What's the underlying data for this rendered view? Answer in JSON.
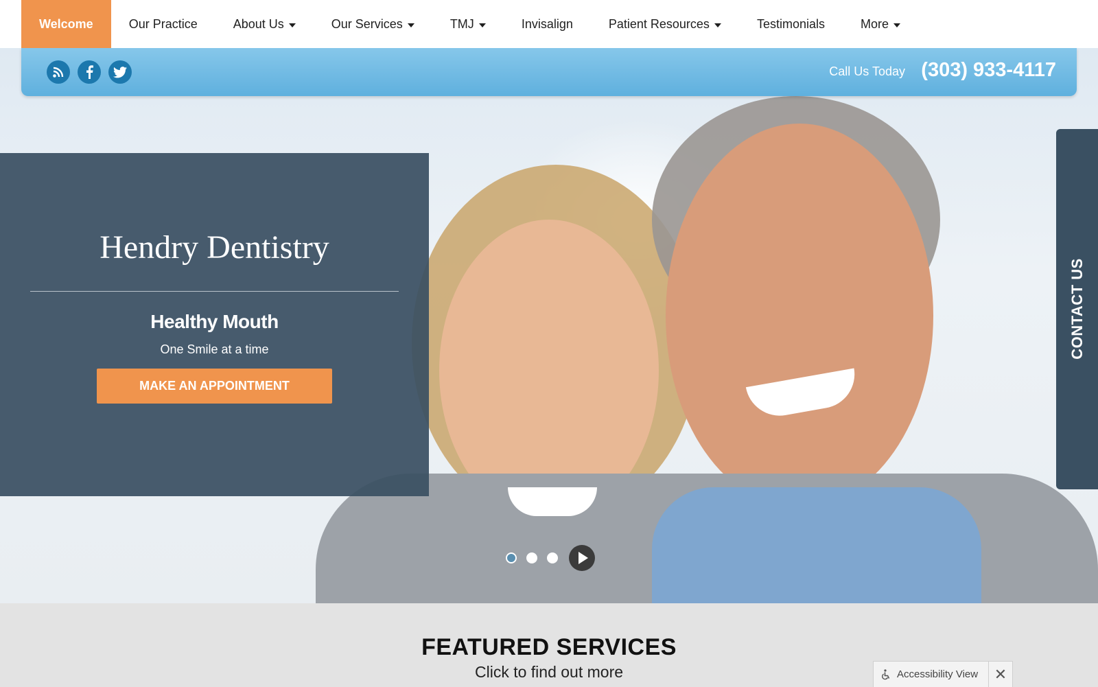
{
  "nav": {
    "items": [
      {
        "label": "Welcome"
      },
      {
        "label": "Our Practice"
      },
      {
        "label": "About Us"
      },
      {
        "label": "Our Services"
      },
      {
        "label": "TMJ"
      },
      {
        "label": "Invisalign"
      },
      {
        "label": "Patient Resources"
      },
      {
        "label": "Testimonials"
      },
      {
        "label": "More"
      }
    ]
  },
  "topbar": {
    "social_icons": [
      "rss-icon",
      "facebook-icon",
      "twitter-icon"
    ],
    "call_label": "Call Us Today",
    "phone": "(303) 933-4117"
  },
  "hero": {
    "title": "Hendry Dentistry",
    "heading": "Healthy Mouth",
    "subheading": "One Smile at a time",
    "cta_label": "MAKE AN APPOINTMENT",
    "slides": 3,
    "active_slide": 1
  },
  "contact_tab": {
    "label": "CONTACT US"
  },
  "featured": {
    "title": "FEATURED SERVICES",
    "subtitle": "Click to find out more"
  },
  "accessibility": {
    "label": "Accessibility View"
  },
  "colors": {
    "accent": "#f0944d",
    "panel": "#3a5062",
    "info_bar": "#6cb8e2",
    "social_icon_bg": "#1c78ad"
  }
}
